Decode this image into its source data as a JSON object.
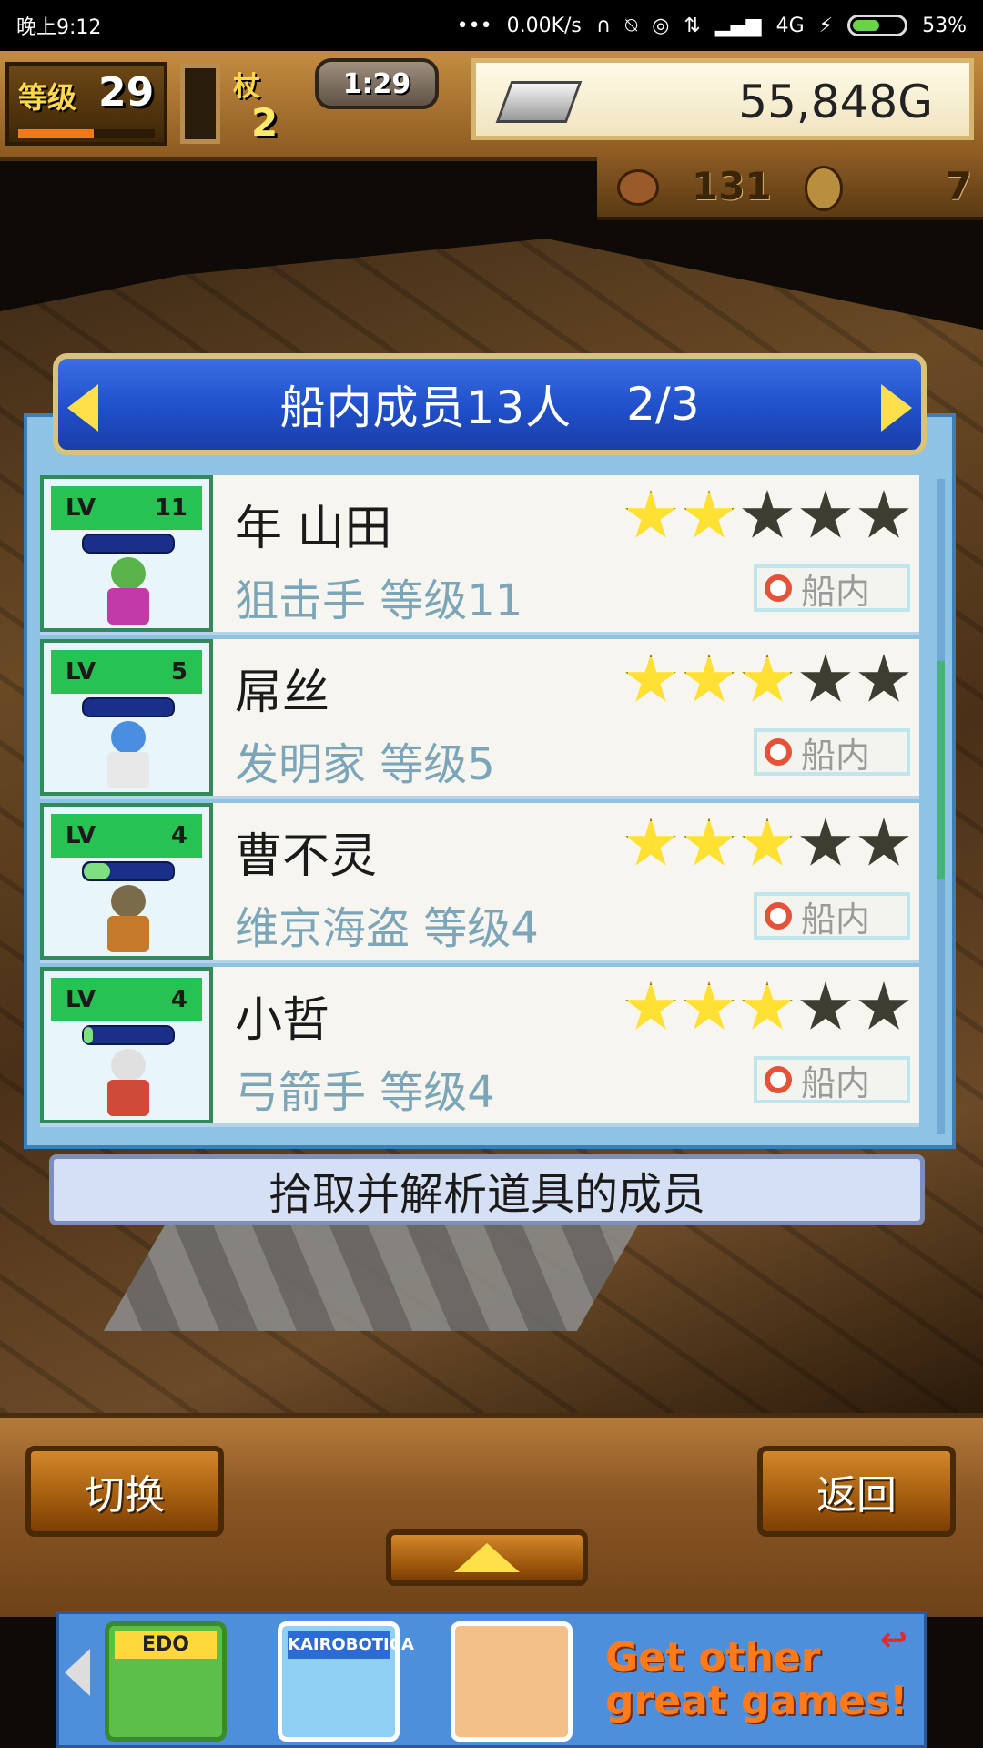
{
  "statusbar": {
    "time": "晚上9:12",
    "speed": "0.00K/s",
    "network": "4G",
    "battery": "53%",
    "battery_level": 0.53
  },
  "hud": {
    "level_label": "等级",
    "level_value": "29",
    "exp_fraction": 0.55,
    "turn_icon": "杖",
    "turn_value": "2",
    "time": "1:29",
    "money": "55,848G",
    "food": "131",
    "coin": "7"
  },
  "panel": {
    "title": "船内成员13人",
    "page": "2/3",
    "info": "拾取并解析道具的成员"
  },
  "members": [
    {
      "lv_label": "LV",
      "lv": "11",
      "name": "年 山田",
      "job": "狙击手 等级11",
      "stars": 2,
      "location": "船内",
      "hp": 0.0,
      "head_color": "#59b34a",
      "body_color": "#c23aa8"
    },
    {
      "lv_label": "LV",
      "lv": "5",
      "name": "屌丝",
      "job": "发明家 等级5",
      "stars": 3,
      "location": "船内",
      "hp": 0.0,
      "head_color": "#4a8ee0",
      "body_color": "#e8e8e8"
    },
    {
      "lv_label": "LV",
      "lv": "4",
      "name": "曹不灵",
      "job": "维京海盗 等级4",
      "stars": 3,
      "location": "船内",
      "hp": 0.3,
      "head_color": "#7a6b4a",
      "body_color": "#c47a2a"
    },
    {
      "lv_label": "LV",
      "lv": "4",
      "name": "小哲",
      "job": "弓箭手 等级4",
      "stars": 3,
      "location": "船内",
      "hp": 0.1,
      "head_color": "#e0e0e0",
      "body_color": "#d04a3a"
    }
  ],
  "buttons": {
    "switch": "切换",
    "back": "返回"
  },
  "ad": {
    "tile1": "EDO",
    "tile2": "KAIROBOTICA",
    "line1": "Get other",
    "line2": "great games!",
    "return_icon": "↩"
  },
  "colors": {
    "title_blue": "#1f4fc9",
    "panel_blue": "#8fc3e6",
    "star_on": "#ffe033",
    "star_off": "#3d3d31",
    "lv_green": "#27c254"
  }
}
